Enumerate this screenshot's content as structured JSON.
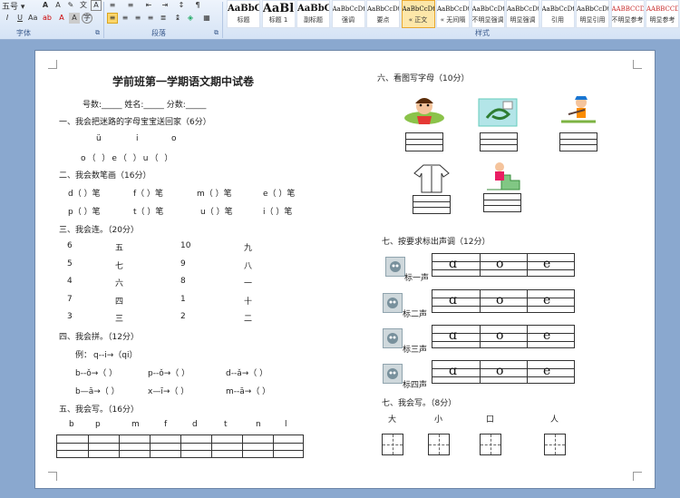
{
  "ribbon": {
    "font_size_value": "五号",
    "group_font": "字体",
    "group_paragraph": "段落",
    "group_styles": "样式",
    "styles": [
      {
        "preview": "AaBbC",
        "name": "标题"
      },
      {
        "preview": "AaBl",
        "name": "标题 1"
      },
      {
        "preview": "AaBbC",
        "name": "副标题"
      },
      {
        "preview": "AaBbCcDt",
        "name": "强调"
      },
      {
        "preview": "AaBbCcDt",
        "name": "要点"
      },
      {
        "preview": "AaBbCcDt",
        "name": "« 正文"
      },
      {
        "preview": "AaBbCcDt",
        "name": "« 无间隔"
      },
      {
        "preview": "AaBbCcDt",
        "name": "不明显强调"
      },
      {
        "preview": "AaBbCcDt",
        "name": "明显强调"
      },
      {
        "preview": "AaBbCcDt",
        "name": "引用"
      },
      {
        "preview": "AaBbCcDt",
        "name": "明显引用"
      },
      {
        "preview": "AABBCCDD",
        "name": "不明显参考"
      },
      {
        "preview": "AABBCCDD",
        "name": "明显参考"
      }
    ]
  },
  "doc": {
    "title": "学前班第一学期语文期中试卷",
    "header_fields": "号数:_____    姓名:_____    分数:_____",
    "s1": {
      "heading": "一、我会把迷路的字母宝宝送回家（6分）",
      "row1": [
        "ü",
        "i",
        "o"
      ],
      "row2": "o（  ）e（  ）u（  ）"
    },
    "s2": {
      "heading": "二、我会数笔画（16分）",
      "row1": [
        "d（  ）笔",
        "f（  ）笔",
        "m（  ）笔",
        "e（  ）笔"
      ],
      "row2": [
        "p（  ）笔",
        "t（  ）笔",
        "u（  ）笔",
        "i（  ）笔"
      ]
    },
    "s3": {
      "heading": "三、我会连。（20分）",
      "col1": [
        "6",
        "5",
        "4",
        "7",
        "3"
      ],
      "col2": [
        "五",
        "七",
        "六",
        "四",
        "三"
      ],
      "col3": [
        "10",
        "9",
        "8",
        "1",
        "2"
      ],
      "col4": [
        "九",
        "八",
        "一",
        "十",
        "二"
      ]
    },
    "s4": {
      "heading": "四、我会拼。（12分）",
      "example_prefix": "例：",
      "example": "q--i→（qi）",
      "rows": [
        [
          "b--ǒ→（  ）",
          "p--ǒ→（  ）",
          "d--ǎ→（  ）"
        ],
        [
          "b—ā→（  ）",
          "x—ī→（  ）",
          "m--ā→（  ）"
        ]
      ]
    },
    "s5": {
      "heading": "五、我会写。（16分）",
      "letters": [
        "b",
        "p",
        "m",
        "f",
        "d",
        "t",
        "n",
        "l"
      ]
    },
    "s6": {
      "heading": "六、看图写字母（10分）"
    },
    "s7a": {
      "heading": "七、按要求标出声调（12分）",
      "rows": [
        "标一声",
        "标二声",
        "标三声",
        "标四声"
      ],
      "cells": [
        "ɑ",
        "o",
        "e"
      ]
    },
    "s7b": {
      "heading": "七、我会写。（8分）",
      "chars": [
        "大",
        "小",
        "口",
        "人"
      ]
    }
  }
}
